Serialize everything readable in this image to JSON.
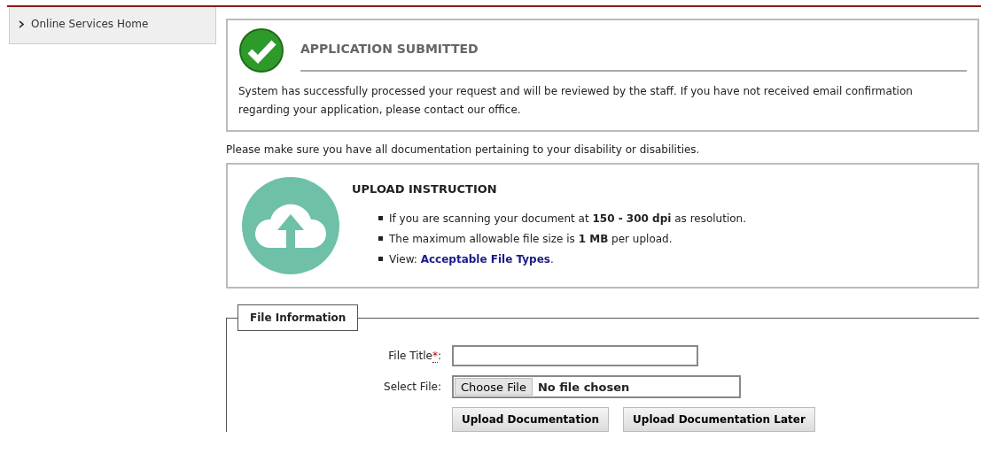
{
  "sidebar": {
    "items": [
      {
        "label": "Online Services Home",
        "selected": false
      }
    ]
  },
  "success": {
    "title": "APPLICATION SUBMITTED",
    "message": "System has successfully processed your request and will be reviewed by the staff. If you have not received email confirmation regarding your application, please contact our office."
  },
  "notice": "Please make sure you have all documentation pertaining to your disability or disabilities.",
  "upload_instruction": {
    "title": "UPLOAD INSTRUCTION",
    "items": [
      {
        "text": "If you are scanning your document at **150 - 300 dpi** as resolution."
      },
      {
        "text": "The maximum allowable file size is **1 MB** per upload."
      },
      {
        "text": "View:",
        "link": "Acceptable File Types",
        "tail": "."
      }
    ]
  },
  "file_information": {
    "legend": "File Information",
    "fields": [
      {
        "kind": "text",
        "label": "File Title",
        "required_mark": "*",
        "suffix": ":"
      },
      {
        "kind": "file",
        "label": "Select File:",
        "button": "Choose File",
        "status": "No file chosen"
      }
    ],
    "buttons": [
      "Upload Documentation",
      "Upload Documentation Later"
    ]
  }
}
